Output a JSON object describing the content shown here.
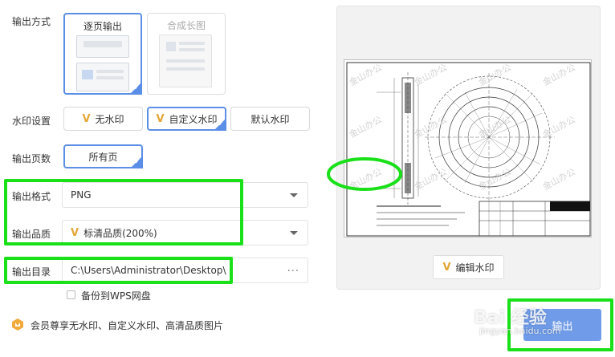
{
  "labels": {
    "output_mode": "输出方式",
    "watermark_setting": "水印设置",
    "output_pages": "输出页数",
    "output_format": "输出格式",
    "output_quality": "输出品质",
    "output_dir": "输出目录"
  },
  "output_mode": {
    "page_by_page": "逐页输出",
    "merge_long": "合成长图"
  },
  "watermark": {
    "none": "无水印",
    "custom": "自定义水印",
    "default": "默认水印"
  },
  "pages": {
    "all": "所有页"
  },
  "format": {
    "value": "PNG"
  },
  "quality": {
    "value": "标清品质(200%)"
  },
  "directory": {
    "value": "C:\\Users\\Administrator\\Desktop\\",
    "more": "···"
  },
  "backup": {
    "label": "备份到WPS网盘"
  },
  "vip_note": "会员尊享无水印、自定义水印、高清品质图片",
  "preview": {
    "watermark_text": "金山办公",
    "edit_watermark": "编辑水印"
  },
  "output_button": "输出",
  "site_watermark": {
    "brand": "Bai 经验",
    "url": "jingyan.baidu.com"
  },
  "colors": {
    "accent": "#5b8ee6",
    "highlight": "#19e019",
    "vip": "#e3a637",
    "primary_button": "#6f9be8"
  }
}
